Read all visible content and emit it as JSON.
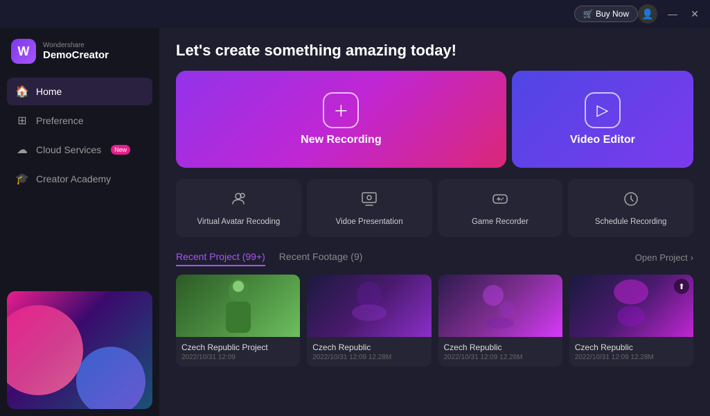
{
  "titleBar": {
    "buyNow": "🛒 Buy Now",
    "minimize": "—",
    "close": "✕"
  },
  "logo": {
    "brand": "Wondershare",
    "name": "DemoCreator"
  },
  "sidebar": {
    "items": [
      {
        "id": "home",
        "label": "Home",
        "icon": "🏠",
        "active": true
      },
      {
        "id": "preference",
        "label": "Preference",
        "icon": "⊞"
      },
      {
        "id": "cloud-services",
        "label": "Cloud Services",
        "icon": "☁",
        "badge": "New"
      },
      {
        "id": "creator-academy",
        "label": "Creator Academy",
        "icon": "🎓"
      }
    ]
  },
  "content": {
    "title": "Let's create something amazing today!",
    "mainActions": [
      {
        "id": "new-recording",
        "label": "New Recording",
        "icon": "＋"
      },
      {
        "id": "video-editor",
        "label": "Video Editor",
        "icon": "▷"
      }
    ],
    "tools": [
      {
        "id": "virtual-avatar",
        "label": "Virtual Avatar Recoding",
        "icon": "👤"
      },
      {
        "id": "video-presentation",
        "label": "Vidoe Presentation",
        "icon": "🖼"
      },
      {
        "id": "game-recorder",
        "label": "Game Recorder",
        "icon": "🎮"
      },
      {
        "id": "schedule-recording",
        "label": "Schedule Recording",
        "icon": "🕐"
      }
    ],
    "recentTabs": [
      {
        "id": "recent-project",
        "label": "Recent Project (99+)",
        "active": true
      },
      {
        "id": "recent-footage",
        "label": "Recent Footage (9)",
        "active": false
      }
    ],
    "openProject": "Open Project",
    "projects": [
      {
        "id": 1,
        "name": "Czech Republic Project",
        "date": "2022/10/31 12:09",
        "size": "",
        "thumb": "1"
      },
      {
        "id": 2,
        "name": "Czech Republic",
        "date": "2022/10/31 12:09",
        "size": "12.28M",
        "thumb": "2"
      },
      {
        "id": 3,
        "name": "Czech Republic",
        "date": "2022/10/31 12:09",
        "size": "12.28M",
        "thumb": "3"
      },
      {
        "id": 4,
        "name": "Czech Republic",
        "date": "2022/10/31 12:09",
        "size": "12.28M",
        "thumb": "4"
      }
    ]
  }
}
